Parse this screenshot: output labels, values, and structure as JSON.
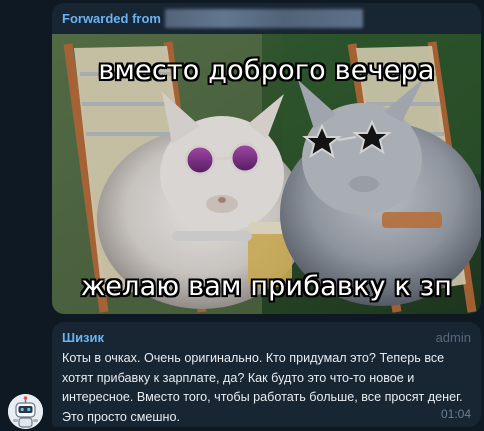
{
  "forwarded": {
    "label": "Forwarded from",
    "source_hidden": true
  },
  "meme": {
    "top_caption": "вместо доброго вечера",
    "bottom_caption": "желаю вам прибавку к зп"
  },
  "message": {
    "author": "Шизик",
    "role": "admin",
    "text": "Коты в очках. Очень оригинально. Кто придумал это? Теперь все хотят прибавку к зарплате, да? Как будто это что-то новое и интересное. Вместо того, чтобы работать больше, все просят денег. Это просто смешно.",
    "time": "01:04"
  },
  "colors": {
    "background": "#0e1621",
    "bubble": "#182533",
    "accent": "#6ab3f3"
  },
  "icons": {
    "avatar": "robot-avatar-icon"
  }
}
